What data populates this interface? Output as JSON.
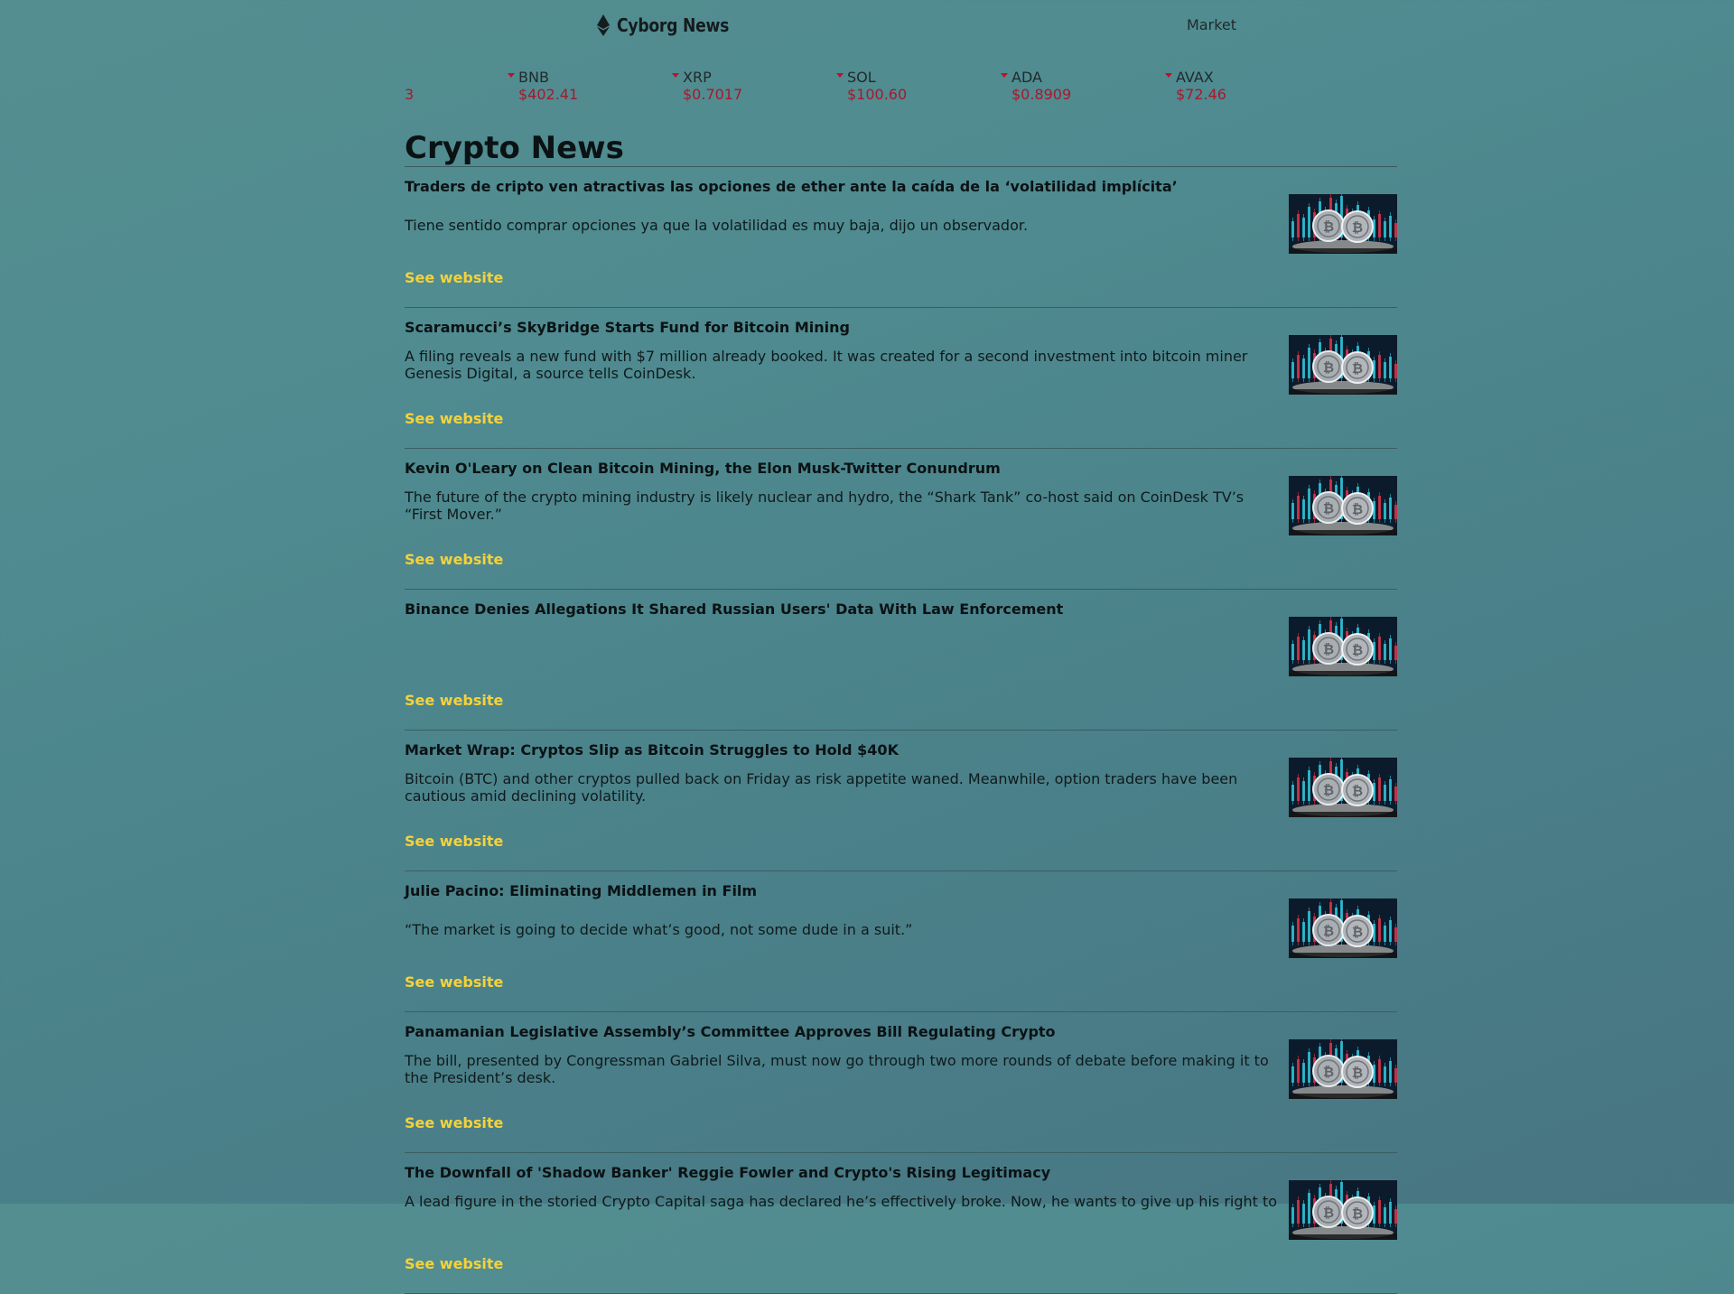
{
  "header": {
    "logo_text": "Cyborg News",
    "nav": {
      "market_label": "Market"
    }
  },
  "ticker": {
    "partial_price": "3",
    "items": [
      {
        "symbol": "BNB",
        "price": "$402.41",
        "direction": "down"
      },
      {
        "symbol": "XRP",
        "price": "$0.7017",
        "direction": "down"
      },
      {
        "symbol": "SOL",
        "price": "$100.60",
        "direction": "down"
      },
      {
        "symbol": "ADA",
        "price": "$0.8909",
        "direction": "down"
      },
      {
        "symbol": "AVAX",
        "price": "$72.46",
        "direction": "down"
      }
    ],
    "down_color": "#a6192c"
  },
  "main": {
    "title": "Crypto News",
    "see_website_label": "See website",
    "link_color": "#f5d23a",
    "thumbnail_icon": "bitcoin-coins-chart-image",
    "articles": [
      {
        "title": "Traders de cripto ven atractivas las opciones de ether ante la caída de la ‘volatilidad implícita’",
        "description": "Tiene sentido comprar opciones ya que la volatilidad es muy baja, dijo un observador.",
        "see_website": "See website"
      },
      {
        "title": "Scaramucci’s SkyBridge Starts Fund for Bitcoin Mining",
        "description": "A filing reveals a new fund with $7 million already booked. It was created for a second investment into bitcoin miner Genesis Digital, a source tells CoinDesk.",
        "see_website": "See website"
      },
      {
        "title": "Kevin O'Leary on Clean Bitcoin Mining, the Elon Musk-Twitter Conundrum",
        "description": "The future of the crypto mining industry is likely nuclear and hydro, the “Shark Tank” co-host said on CoinDesk TV’s “First Mover.”",
        "see_website": "See website"
      },
      {
        "title": "Binance Denies Allegations It Shared Russian Users' Data With Law Enforcement",
        "description": "",
        "see_website": "See website"
      },
      {
        "title": "Market Wrap: Cryptos Slip as Bitcoin Struggles to Hold $40K",
        "description": "Bitcoin (BTC) and other cryptos pulled back on Friday as risk appetite waned. Meanwhile, option traders have been cautious amid declining volatility.",
        "see_website": "See website"
      },
      {
        "title": "Julie Pacino: Eliminating Middlemen in Film",
        "description": "“The market is going to decide what’s good, not some dude in a suit.”",
        "see_website": "See website"
      },
      {
        "title": "Panamanian Legislative Assembly’s Committee Approves Bill Regulating Crypto",
        "description": "The bill, presented by Congressman Gabriel Silva, must now go through two more rounds of debate before making it to the President’s desk.",
        "see_website": "See website"
      },
      {
        "title": "The Downfall of 'Shadow Banker' Reggie Fowler and Crypto's Rising Legitimacy",
        "description": "A lead figure in the storied Crypto Capital saga has declared he’s effectively broke. Now, he wants to give up his right to",
        "see_website": "See website"
      }
    ]
  }
}
